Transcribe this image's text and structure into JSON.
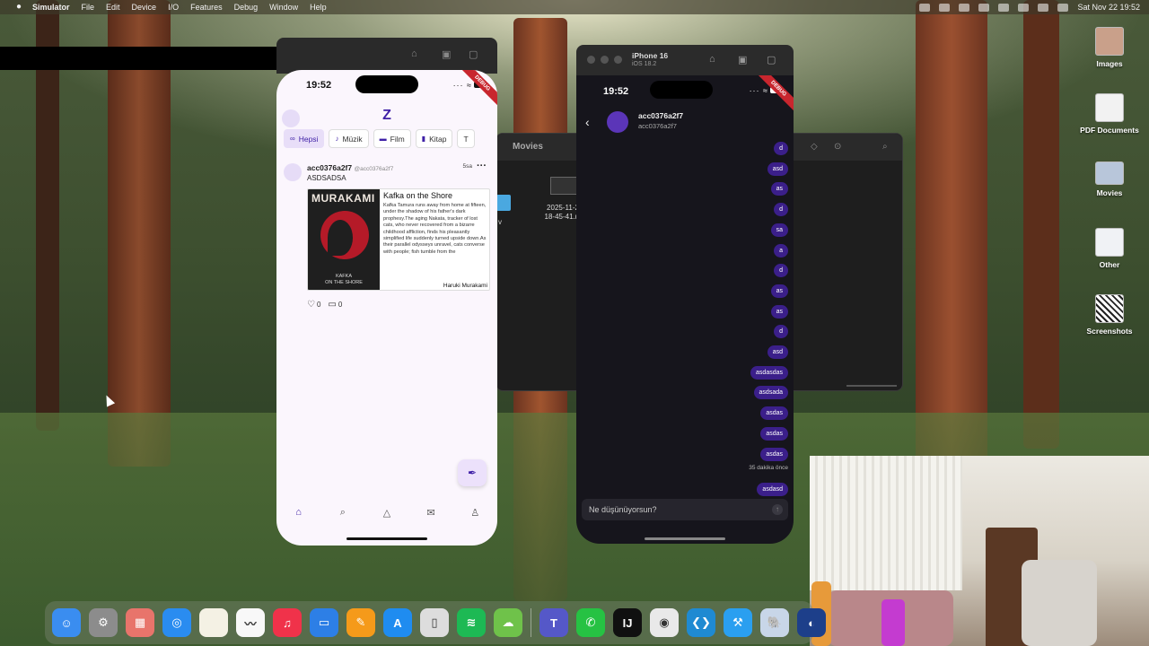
{
  "menubar": {
    "app_name": "Simulator",
    "items": [
      "File",
      "Edit",
      "Device",
      "I/O",
      "Features",
      "Debug",
      "Window",
      "Help"
    ],
    "clock": "Sat Nov 22  19:52"
  },
  "desktop": {
    "icons": [
      {
        "label": "Images",
        "icon": "images-folder-icon"
      },
      {
        "label": "PDF Documents",
        "icon": "pdf-documents-icon"
      },
      {
        "label": "Movies",
        "icon": "movies-folder-icon"
      },
      {
        "label": "Other",
        "icon": "other-folder-icon"
      },
      {
        "label": "Screenshots",
        "icon": "screenshots-folder-icon"
      }
    ]
  },
  "finder": {
    "title": "Movies",
    "file_name_line1": "2025-11-2",
    "file_name_line2": "18-45-41.m",
    "partial_label": "v"
  },
  "sim_light": {
    "time": "19:52",
    "debug_label": "DEBUG",
    "logo": "Z",
    "chips": [
      {
        "label": "Hepsi",
        "icon": "∞"
      },
      {
        "label": "Müzik",
        "icon": "♪"
      },
      {
        "label": "Film",
        "icon": "▬"
      },
      {
        "label": "Kitap",
        "icon": "▮"
      },
      {
        "label": "T",
        "icon": ""
      }
    ],
    "post": {
      "username": "acc0376a2f7",
      "handle": "@acc0376a2f7",
      "time": "5sa",
      "text": "ASDSADSA",
      "book": {
        "cover_author": "MURAKAMI",
        "cover_title_line1": "KAFKA",
        "cover_title_line2": "ON THE SHORE",
        "title": "Kafka on the Shore",
        "description": "Kafka Tamura runs away from home at fifteen, under the shadow of his father's dark prophesy.The aging Nakata, tracker of lost cats, who never recovered from a bizarre childhood affliction, finds his pleasantly simplified life suddenly turned upside down.As their parallel odysseys unravel, cats converse with people; fish tumble from the",
        "author": "Haruki Murakami"
      },
      "likes": "0",
      "comments": "0"
    },
    "tabs": [
      "home-icon",
      "search-icon",
      "bell-icon",
      "mail-icon",
      "profile-icon"
    ]
  },
  "sim_dark": {
    "device_name": "iPhone 16",
    "device_os": "iOS 18.2",
    "time": "19:52",
    "debug_label": "DEBUG",
    "chat_name": "acc0376a2f7",
    "chat_handle": "acc0376a2f7",
    "messages": [
      "d",
      "asd",
      "as",
      "d",
      "sa",
      "a",
      "d",
      "as",
      "as",
      "d",
      "asd",
      "asdasdas",
      "asdsada",
      "asdas",
      "asdas",
      "asdas"
    ],
    "timestamp": "35 dakika önce",
    "last_message": "asdasd",
    "input_placeholder": "Ne düşünüyorsun?"
  },
  "dock": {
    "apps": [
      {
        "name": "finder-icon",
        "color": "#3a8df0",
        "glyph": "☺"
      },
      {
        "name": "system-settings-icon",
        "color": "#8c8c8c",
        "glyph": "⚙"
      },
      {
        "name": "launchpad-icon",
        "color": "#e8746b",
        "glyph": "▦"
      },
      {
        "name": "safari-icon",
        "color": "#2a8cf0",
        "glyph": "◎"
      },
      {
        "name": "notes-icon",
        "color": "#f4f1e4",
        "glyph": ""
      },
      {
        "name": "freeform-icon",
        "color": "#f8f8f8",
        "glyph": "〰"
      },
      {
        "name": "music-icon",
        "color": "#f0324a",
        "glyph": "♫"
      },
      {
        "name": "keynote-icon",
        "color": "#2d7fe6",
        "glyph": "▭"
      },
      {
        "name": "pages-icon",
        "color": "#f59a1a",
        "glyph": "✎"
      },
      {
        "name": "app-store-icon",
        "color": "#1f8cf0",
        "glyph": "A"
      },
      {
        "name": "simulator-icon",
        "color": "#ddd",
        "glyph": "▯"
      },
      {
        "name": "spotify-icon",
        "color": "#1db954",
        "glyph": "≋"
      },
      {
        "name": "android-studio-icon",
        "color": "#6fc24a",
        "glyph": "☁"
      },
      {
        "name": "teams-icon",
        "color": "#5558c8",
        "glyph": "T"
      },
      {
        "name": "whatsapp-icon",
        "color": "#26c243",
        "glyph": "✆"
      },
      {
        "name": "intellij-icon",
        "color": "#101010",
        "glyph": "IJ"
      },
      {
        "name": "chrome-icon",
        "color": "#e9e9e9",
        "glyph": "◉"
      },
      {
        "name": "vscode-icon",
        "color": "#1f8ad2",
        "glyph": "❮❯"
      },
      {
        "name": "xcode-icon",
        "color": "#2a9ff0",
        "glyph": "⚒"
      },
      {
        "name": "postgres-icon",
        "color": "#c8d6e8",
        "glyph": "🐘"
      },
      {
        "name": "dock-extra-icon",
        "color": "#1d3f8a",
        "glyph": "◐"
      }
    ]
  },
  "colors": {
    "accent": "#3e1fa6",
    "bubble": "#3b1f8a",
    "dark_bg": "#16151c",
    "light_bg": "#fbf6fd"
  }
}
